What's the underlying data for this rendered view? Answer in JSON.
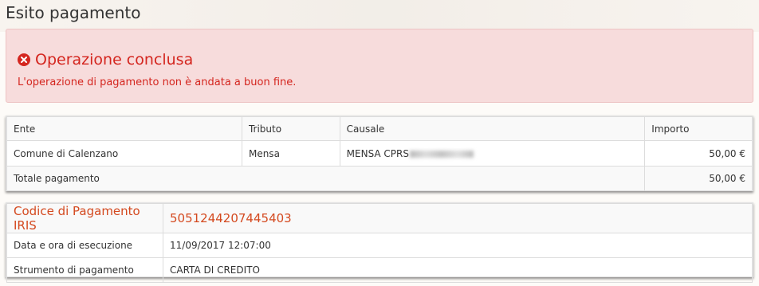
{
  "page": {
    "title": "Esito pagamento"
  },
  "alert": {
    "title": "Operazione conclusa",
    "message": "L'operazione di pagamento non è andata a buon fine.",
    "color": "#d4261f",
    "background": "#f7dcdc"
  },
  "payment_table": {
    "headers": {
      "ente": "Ente",
      "tributo": "Tributo",
      "causale": "Causale",
      "importo": "Importo"
    },
    "row": {
      "ente": "Comune di Calenzano",
      "tributo": "Mensa",
      "causale": "MENSA CPRS",
      "importo": "50,00 €"
    },
    "total": {
      "label": "Totale pagamento",
      "value": "50,00 €"
    }
  },
  "details": {
    "iris_label": "Codice di Pagamento IRIS",
    "iris_value": "5051244207445403",
    "datetime_label": "Data e ora di esecuzione",
    "datetime_value": "11/09/2017 12:07:00",
    "method_label": "Strumento di pagamento",
    "method_value": "CARTA DI CREDITO",
    "accent_color": "#d4491f"
  }
}
